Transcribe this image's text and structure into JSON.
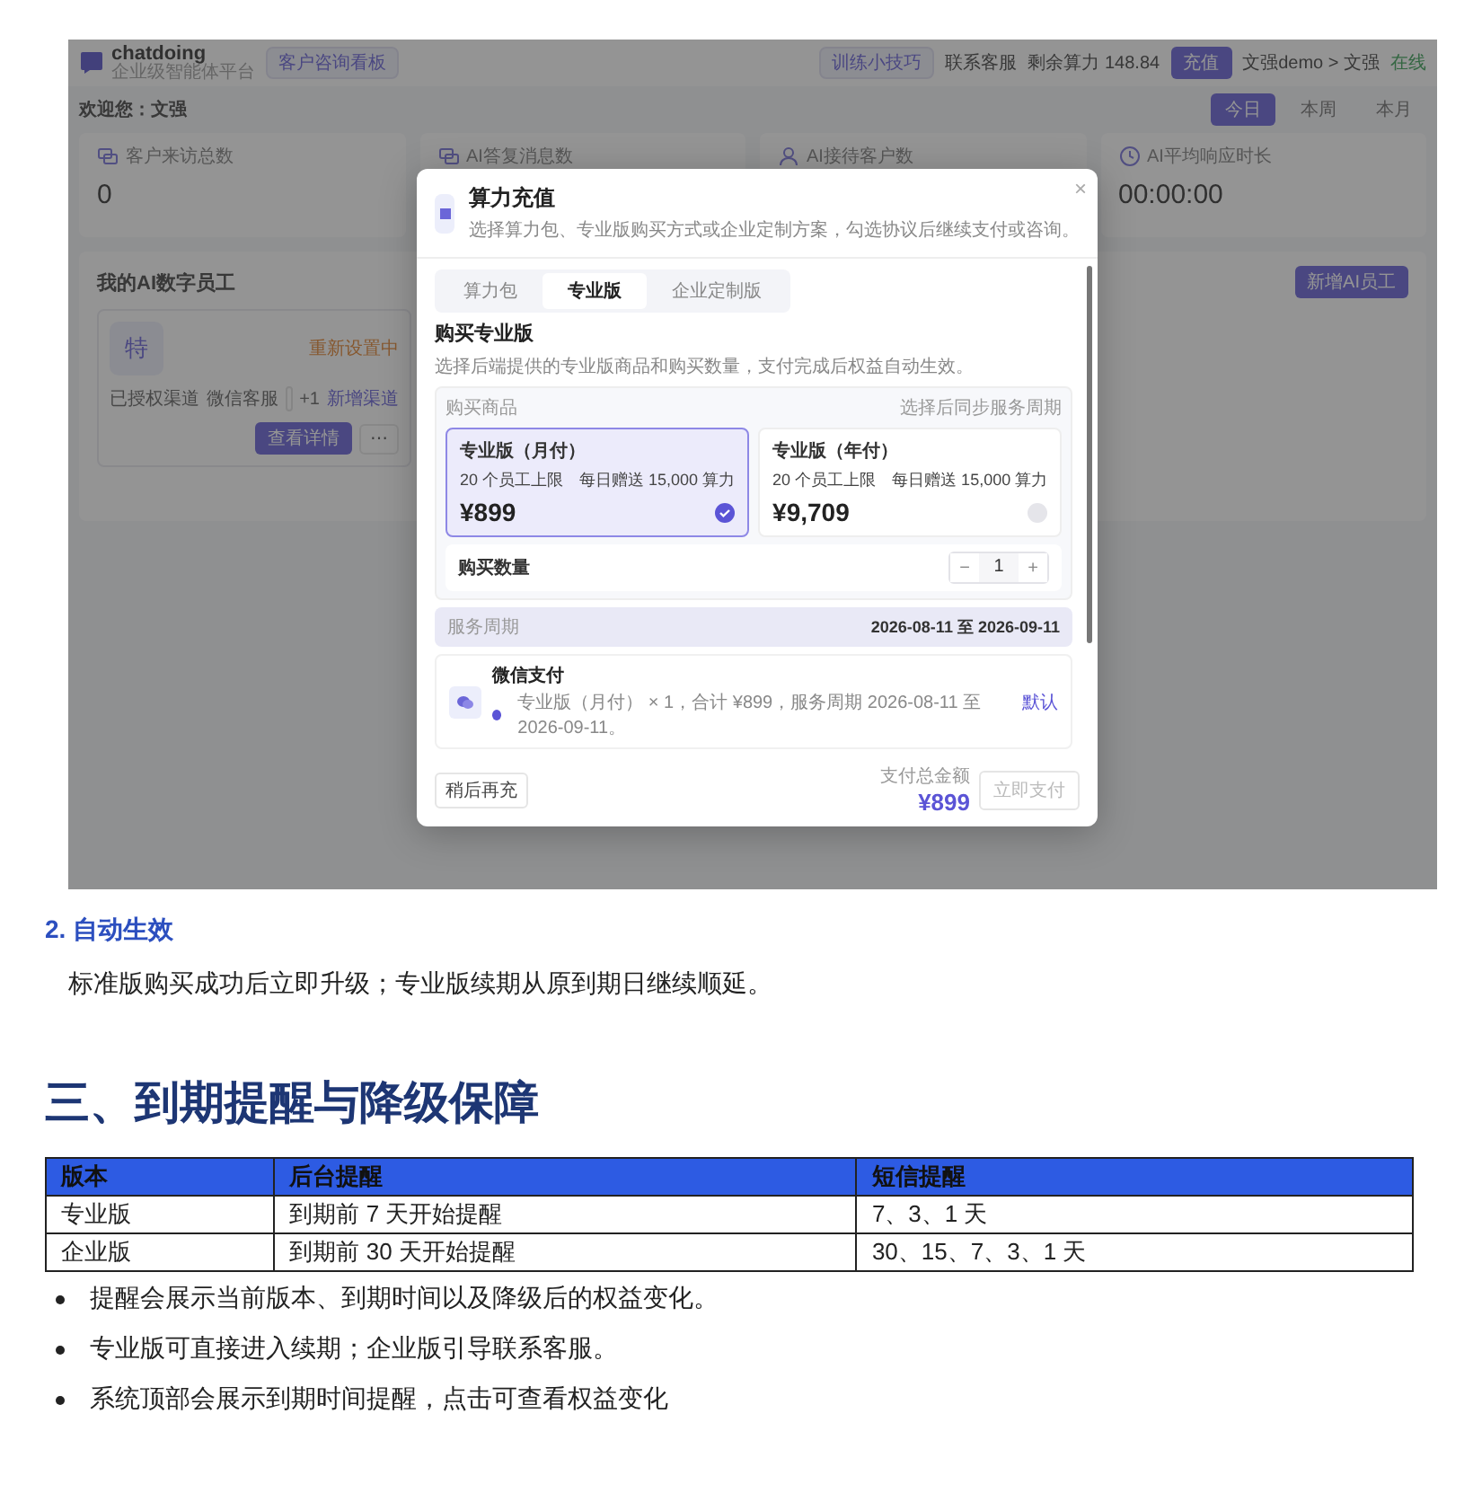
{
  "app": {
    "logo": "chatdoing",
    "logo_sub": "企业级智能体平台",
    "board_button": "客户咨询看板",
    "tips": "训练小技巧",
    "contact": "联系客服",
    "balance": "剩余算力 148.84",
    "recharge": "充值",
    "user": "文强demo > 文强",
    "online": "在线",
    "welcome": "欢迎您：文强",
    "periods": [
      {
        "label": "今日",
        "selected": true
      },
      {
        "label": "本周",
        "selected": false
      },
      {
        "label": "本月",
        "selected": false
      }
    ],
    "stats": [
      {
        "label": "客户来访总数",
        "value": "0"
      },
      {
        "label": "AI答复消息数"
      },
      {
        "label": "AI接待客户数"
      },
      {
        "label": "AI平均响应时长",
        "value": "00:00:00"
      }
    ],
    "employees_title": "我的AI数字员工",
    "add_employee": "新增AI员工",
    "employee": {
      "avatar": "特",
      "status": "重新设置中",
      "channels_label": "已授权渠道",
      "channel": "微信客服",
      "more": "+1",
      "add_channel": "新增渠道",
      "details": "查看详情",
      "menu": "⋯"
    }
  },
  "modal": {
    "title": "算力充值",
    "subtitle": "选择算力包、专业版购买方式或企业定制方案，勾选协议后继续支付或咨询。",
    "tabs": [
      {
        "label": "算力包",
        "selected": false
      },
      {
        "label": "专业版",
        "selected": true
      },
      {
        "label": "企业定制版",
        "selected": false
      }
    ],
    "heading": "购买专业版",
    "description": "选择后端提供的专业版商品和购买数量，支付完成后权益自动生效。",
    "products_label": "购买商品",
    "products_hint": "选择后同步服务周期",
    "products": [
      {
        "name": "专业版（月付）",
        "features": "20 个员工上限　每日赠送 15,000 算力",
        "price": "¥899",
        "selected": true
      },
      {
        "name": "专业版（年付）",
        "features": "20 个员工上限　每日赠送 15,000 算力",
        "price": "¥9,709",
        "selected": false
      }
    ],
    "quantity_label": "购买数量",
    "quantity": "1",
    "decrement": "−",
    "increment": "+",
    "period_label": "服务周期",
    "period": "2026-08-11 至 2026-09-11",
    "payment_name": "微信支付",
    "payment_detail": "专业版（月付） × 1，合计 ¥899，服务周期 2026-08-11 至 2026-09-11。",
    "payment_default": "默认",
    "later": "稍后再充",
    "total_label": "支付总金额",
    "total": "¥899",
    "pay": "立即支付",
    "close": "×"
  },
  "doc": {
    "subheading": "2. 自动生效",
    "paragraph": "标准版购买成功后立即升级；专业版续期从原到期日继续顺延。",
    "heading": "三、到期提醒与降级保障",
    "table": {
      "columns": [
        "版本",
        "后台提醒",
        "短信提醒"
      ],
      "rows": [
        [
          "专业版",
          "到期前 7 天开始提醒",
          "7、3、1 天"
        ],
        [
          "企业版",
          "到期前 30 天开始提醒",
          "30、15、7、3、1 天"
        ]
      ]
    },
    "bullets": [
      "提醒会展示当前版本、到期时间以及降级后的权益变化。",
      "专业版可直接进入续期；企业版引导联系客服。",
      "系统顶部会展示到期时间提醒，点击可查看权益变化"
    ]
  }
}
